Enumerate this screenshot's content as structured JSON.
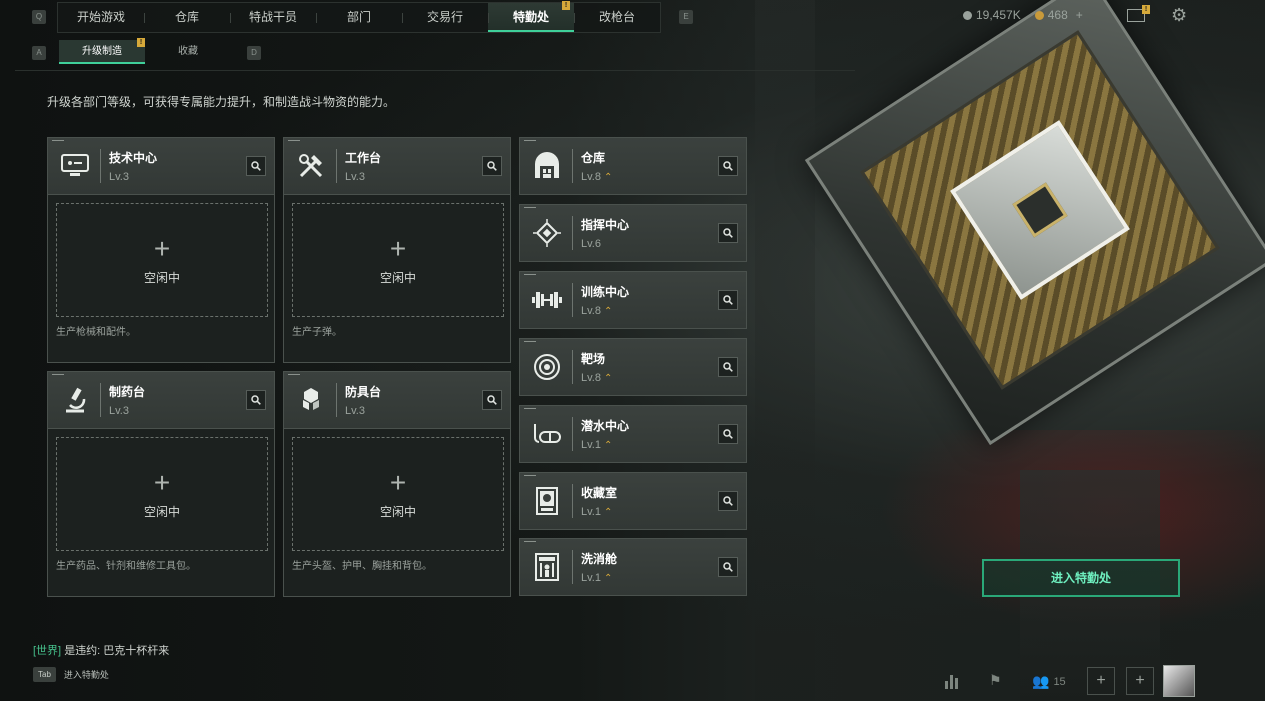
{
  "top_nav": {
    "left_key": "Q",
    "right_key": "E",
    "tabs": [
      {
        "label": "开始游戏"
      },
      {
        "label": "仓库"
      },
      {
        "label": "特战干员"
      },
      {
        "label": "部门"
      },
      {
        "label": "交易行"
      },
      {
        "label": "特勤处",
        "active": true,
        "badge": "!"
      },
      {
        "label": "改枪台"
      }
    ]
  },
  "resources": {
    "currency_a": "19,457K",
    "currency_b": "468",
    "plus": "+",
    "mail_badge": "!"
  },
  "sub_nav": {
    "left_key": "A",
    "right_key": "D",
    "tabs": [
      {
        "label": "升级制造",
        "active": true,
        "badge": "!"
      },
      {
        "label": "收藏"
      }
    ]
  },
  "description": "升级各部门等级，可获得专属能力提升，和制造战斗物资的能力。",
  "workstations": [
    {
      "name": "技术中心",
      "level": "Lv.3",
      "idle": "空闲中",
      "note": "生产枪械和配件。",
      "icon": "computer-icon"
    },
    {
      "name": "工作台",
      "level": "Lv.3",
      "idle": "空闲中",
      "note": "生产子弹。",
      "icon": "tools-icon"
    },
    {
      "name": "制药台",
      "level": "Lv.3",
      "idle": "空闲中",
      "note": "生产药品、针剂和维修工具包。",
      "icon": "microscope-icon"
    },
    {
      "name": "防具台",
      "level": "Lv.3",
      "idle": "空闲中",
      "note": "生产头盔、护甲、胸挂和背包。",
      "icon": "armor-blocks-icon"
    }
  ],
  "rooms": [
    {
      "name": "仓库",
      "level": "Lv.8",
      "upgradable": true,
      "icon": "warehouse-icon"
    },
    {
      "name": "指挥中心",
      "level": "Lv.6",
      "upgradable": false,
      "icon": "chip-icon"
    },
    {
      "name": "训练中心",
      "level": "Lv.8",
      "upgradable": true,
      "icon": "dumbbell-icon"
    },
    {
      "name": "靶场",
      "level": "Lv.8",
      "upgradable": true,
      "icon": "target-icon"
    },
    {
      "name": "潜水中心",
      "level": "Lv.1",
      "upgradable": true,
      "icon": "diving-mask-icon"
    },
    {
      "name": "收藏室",
      "level": "Lv.1",
      "upgradable": true,
      "icon": "display-case-icon"
    },
    {
      "name": "洗消舱",
      "level": "Lv.1",
      "upgradable": true,
      "icon": "decon-chamber-icon"
    }
  ],
  "up_glyph": "⌃",
  "enter_button": "进入特勤处",
  "chat": {
    "channel": "[世界]",
    "message": "是违约: 巴克十杯杆来"
  },
  "tab_hint": {
    "key": "Tab",
    "label": "进入特勤处"
  },
  "bottom": {
    "friends_count": "15"
  },
  "colors": {
    "accent": "#3fd09a",
    "badge": "#d6a93a"
  }
}
